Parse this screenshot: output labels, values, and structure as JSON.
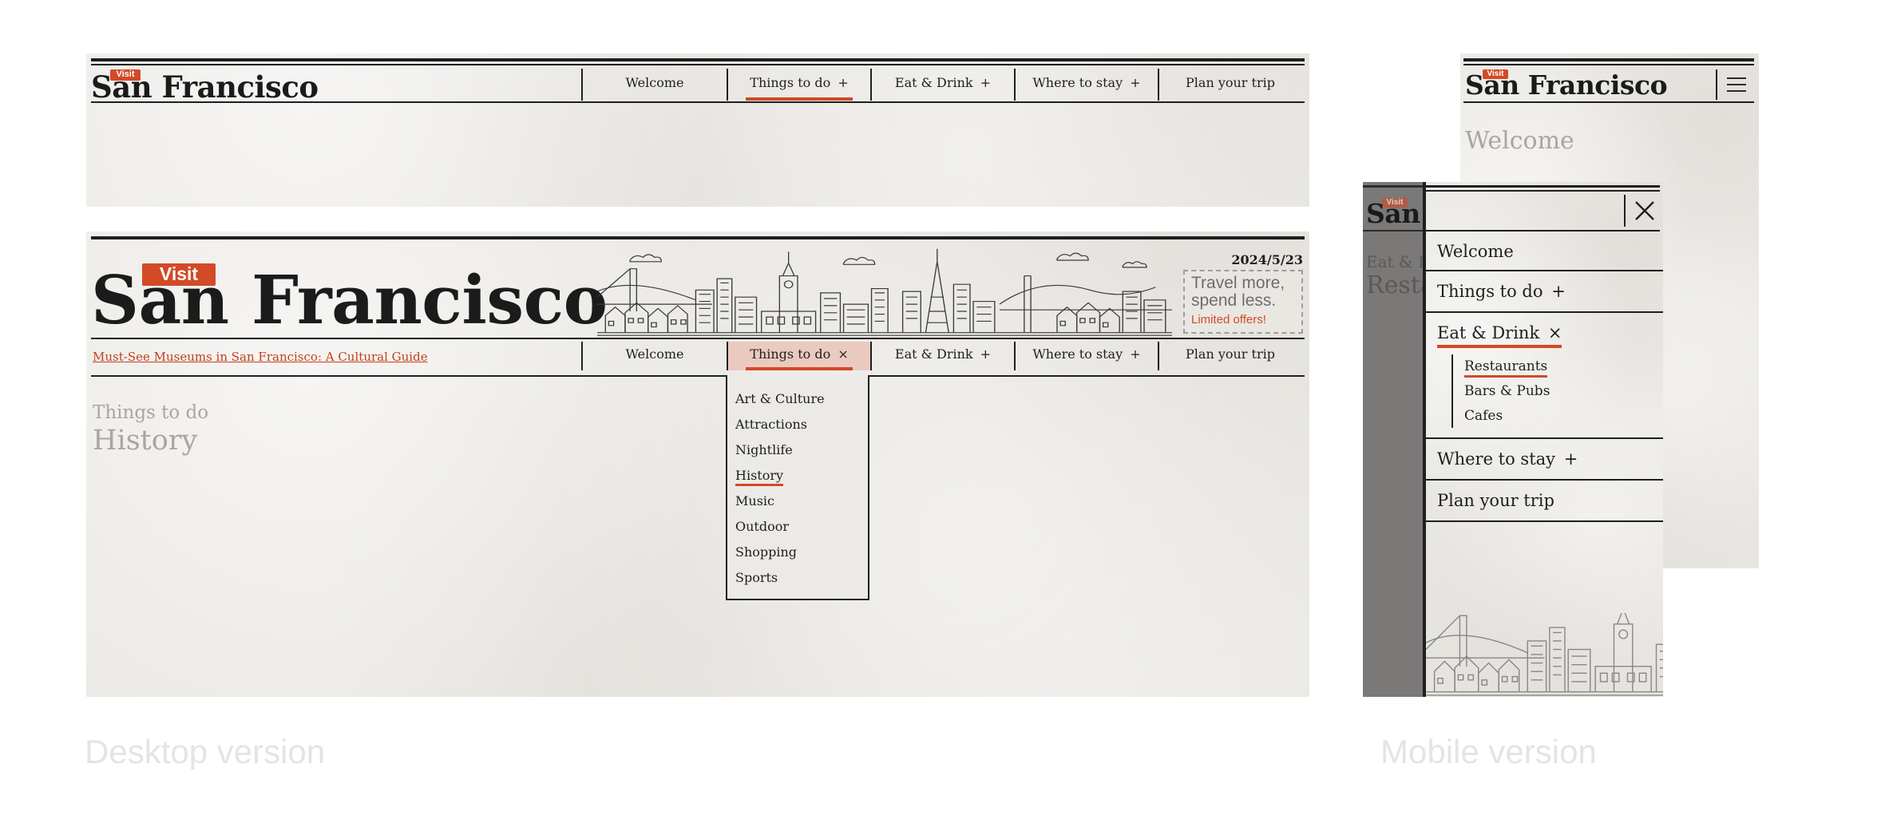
{
  "site": {
    "badge": "Visit",
    "title": "San Francisco",
    "title_short": "San"
  },
  "nav": {
    "items": [
      {
        "label": "Welcome"
      },
      {
        "label": "Things to do",
        "toggle": "+",
        "toggle_open": "×"
      },
      {
        "label": "Eat & Drink",
        "toggle": "+",
        "toggle_open": "×"
      },
      {
        "label": "Where to stay",
        "toggle": "+"
      },
      {
        "label": "Plan your trip"
      }
    ]
  },
  "desktop": {
    "date": "2024/5/23",
    "ad": {
      "line1": "Travel more,",
      "line2": "spend less.",
      "line3": "Limited offers!"
    },
    "featured_link": "Must-See Museums in San Francisco: A Cultural Guide",
    "things_to_do_menu": [
      "Art & Culture",
      "Attractions",
      "Nightlife",
      "History",
      "Music",
      "Outdoor",
      "Shopping",
      "Sports"
    ],
    "page_eyebrow": "Things to do",
    "page_heading": "History"
  },
  "mobile": {
    "page_heading": "Welcome",
    "behind_eyebrow": "Eat & D",
    "behind_heading": "Resta",
    "eat_drink_menu": [
      "Restaurants",
      "Bars & Pubs",
      "Cafes"
    ]
  },
  "captions": {
    "desktop": "Desktop version",
    "mobile": "Mobile version"
  },
  "colors": {
    "accent": "#d24a26",
    "paper": "#ebe9e5",
    "ink": "#1e1e1e",
    "muted": "#a8a6a2",
    "caption": "#e4e4e4"
  }
}
